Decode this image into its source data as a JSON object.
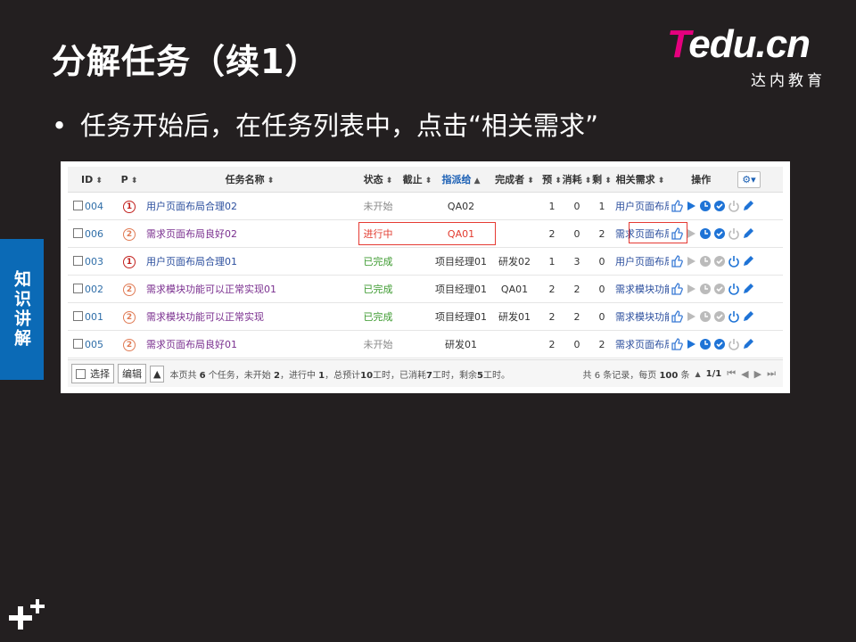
{
  "slide": {
    "title": "分解任务（续1）",
    "bullet": "任务开始后，在任务列表中，点击“相关需求”",
    "side_tab": "知识讲解",
    "logo": {
      "main_t": "T",
      "main_rest": "edu.cn",
      "sub": "达内教育"
    },
    "colors": {
      "background": "#231f20",
      "side_tab": "#0b6ab6",
      "logo_accent": "#e6007e"
    }
  },
  "table": {
    "columns": [
      {
        "label": "ID",
        "sort": "both"
      },
      {
        "label": "P",
        "sort": "both"
      },
      {
        "label": "任务名称",
        "sort": "both"
      },
      {
        "label": "状态",
        "sort": "both"
      },
      {
        "label": "截止",
        "sort": "both"
      },
      {
        "label": "指派给",
        "sort": "asc"
      },
      {
        "label": "完成者",
        "sort": "both"
      },
      {
        "label": "预",
        "sort": "both"
      },
      {
        "label": "消耗",
        "sort": "both"
      },
      {
        "label": "剩",
        "sort": "both"
      },
      {
        "label": "相关需求",
        "sort": "both"
      },
      {
        "label": "操作",
        "sort": "none"
      }
    ],
    "rows": [
      {
        "id": "004",
        "p": "1",
        "name": "用户页面布局合理02",
        "status": "未开始",
        "status_type": "wait",
        "deadline": "",
        "assigned": "QA02",
        "finished_by": "",
        "est": "1",
        "used": "0",
        "left": "1",
        "req": "用户页面布局"
      },
      {
        "id": "006",
        "p": "2",
        "name": "需求页面布局良好02",
        "status": "进行中",
        "status_type": "doing",
        "deadline": "",
        "assigned": "QA01",
        "finished_by": "",
        "est": "2",
        "used": "0",
        "left": "2",
        "req": "需求页面布局"
      },
      {
        "id": "003",
        "p": "1",
        "name": "用户页面布局合理01",
        "status": "已完成",
        "status_type": "done",
        "deadline": "",
        "assigned": "项目经理01",
        "finished_by": "研发02",
        "est": "1",
        "used": "3",
        "left": "0",
        "req": "用户页面布局"
      },
      {
        "id": "002",
        "p": "2",
        "name": "需求模块功能可以正常实现01",
        "status": "已完成",
        "status_type": "done",
        "deadline": "",
        "assigned": "项目经理01",
        "finished_by": "QA01",
        "est": "2",
        "used": "2",
        "left": "0",
        "req": "需求模块功能"
      },
      {
        "id": "001",
        "p": "2",
        "name": "需求模块功能可以正常实现",
        "status": "已完成",
        "status_type": "done",
        "deadline": "",
        "assigned": "项目经理01",
        "finished_by": "研发01",
        "est": "2",
        "used": "2",
        "left": "0",
        "req": "需求模块功能"
      },
      {
        "id": "005",
        "p": "2",
        "name": "需求页面布局良好01",
        "status": "未开始",
        "status_type": "wait",
        "deadline": "",
        "assigned": "研发01",
        "finished_by": "",
        "est": "2",
        "used": "0",
        "left": "2",
        "req": "需求页面布局"
      }
    ]
  },
  "footer": {
    "select_label": "选择",
    "edit_label": "编辑",
    "summary_parts": [
      "本页共 ",
      "6",
      " 个任务，未开始 ",
      "2",
      "，进行中 ",
      "1",
      "，总预计",
      "10",
      "工时，已消耗",
      "7",
      "工时，剩余",
      "5",
      "工时。"
    ],
    "pager_parts": [
      "共 6 条记录，每页 ",
      "100",
      " 条"
    ],
    "page": "1/1"
  }
}
